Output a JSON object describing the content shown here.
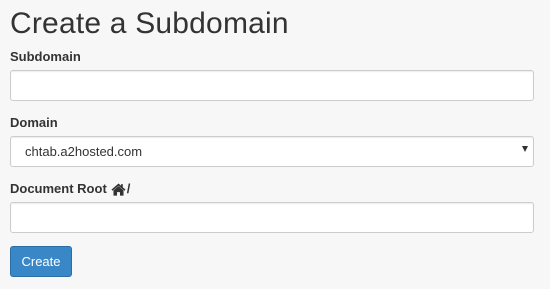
{
  "page": {
    "title": "Create a Subdomain"
  },
  "form": {
    "subdomain": {
      "label": "Subdomain",
      "value": "",
      "placeholder": ""
    },
    "domain": {
      "label": "Domain",
      "selected": "chtab.a2hosted.com"
    },
    "document_root": {
      "label": "Document Root",
      "home_icon": "home-icon",
      "prefix": "/",
      "value": "",
      "placeholder": ""
    },
    "submit_label": "Create"
  },
  "colors": {
    "background": "#f7f7f7",
    "primary_button": "#3a87c8",
    "input_border": "#cccccc",
    "text": "#333333"
  }
}
